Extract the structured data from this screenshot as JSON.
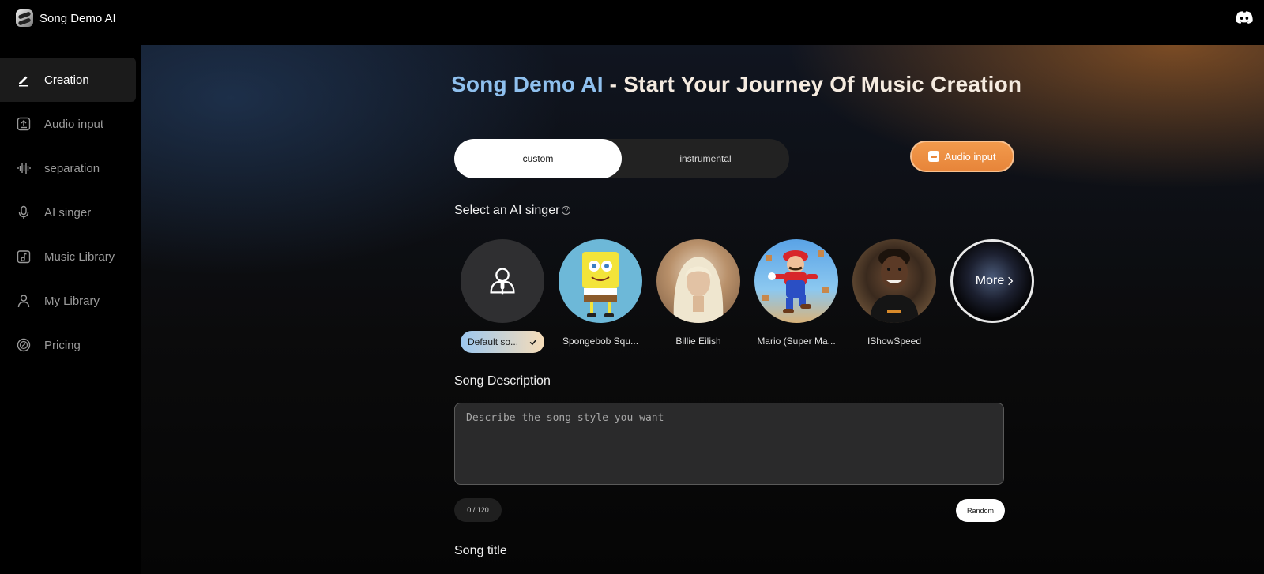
{
  "brand": {
    "name": "Song Demo AI"
  },
  "sidebar": {
    "items": [
      {
        "label": "Creation",
        "icon": "pencil-icon",
        "active": true
      },
      {
        "label": "Audio input",
        "icon": "upload-icon"
      },
      {
        "label": "separation",
        "icon": "waveform-icon"
      },
      {
        "label": "AI singer",
        "icon": "microphone-icon"
      },
      {
        "label": "Music Library",
        "icon": "music-note-icon"
      },
      {
        "label": "My Library",
        "icon": "user-icon"
      },
      {
        "label": "Pricing",
        "icon": "coin-icon"
      }
    ]
  },
  "header": {
    "discord_icon": "discord-icon"
  },
  "main": {
    "title_brand": "Song Demo AI",
    "title_rest": " - Start Your Journey Of Music Creation",
    "tabs": [
      {
        "label": "custom",
        "active": true
      },
      {
        "label": "instrumental",
        "active": false
      }
    ],
    "audio_input_label": "Audio input",
    "singer_section_label": "Select an AI singer",
    "singers": [
      {
        "name": "Default so...",
        "selected": true
      },
      {
        "name": "Spongebob Squ..."
      },
      {
        "name": "Billie Eilish"
      },
      {
        "name": "Mario (Super Ma..."
      },
      {
        "name": "IShowSpeed"
      }
    ],
    "more_label": "More",
    "description_label": "Song Description",
    "description_placeholder": "Describe the song style you want",
    "description_value": "",
    "counter": "0 / 120",
    "random_label": "Random",
    "song_title_label": "Song title"
  },
  "colors": {
    "accent_orange": "#e7853a",
    "title_blue": "#8fc0ee",
    "active_nav_bg": "#1b1b1b"
  }
}
